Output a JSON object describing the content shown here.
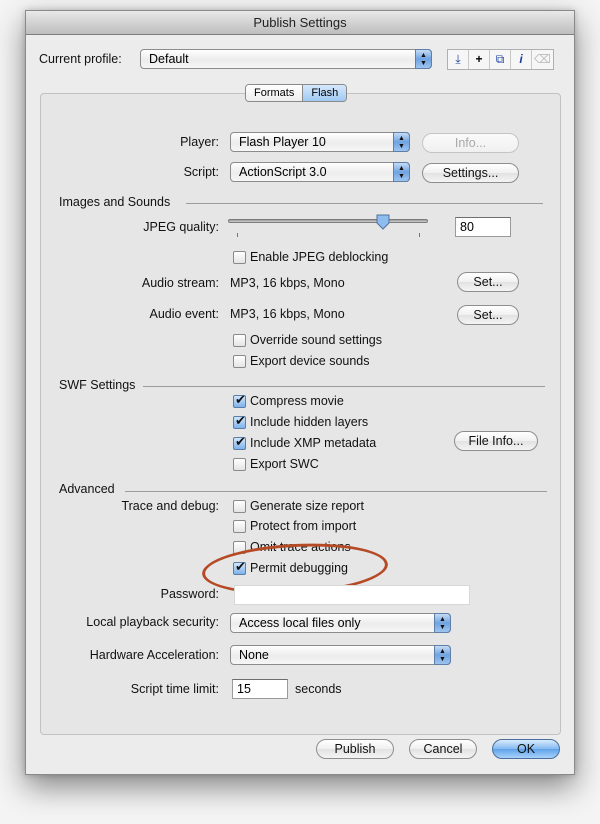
{
  "window": {
    "title": "Publish Settings"
  },
  "profile": {
    "label": "Current profile:",
    "value": "Default",
    "tools": [
      {
        "icon": "import-export-icon",
        "glyph": "⤓"
      },
      {
        "icon": "add-profile-icon",
        "glyph": "+"
      },
      {
        "icon": "duplicate-profile-icon",
        "glyph": "⧉"
      },
      {
        "icon": "profile-info-icon",
        "glyph": "ℹ"
      },
      {
        "icon": "delete-profile-icon",
        "glyph": "🗑"
      }
    ]
  },
  "tabs": [
    {
      "label": "Formats",
      "active": false
    },
    {
      "label": "Flash",
      "active": true
    }
  ],
  "player": {
    "label": "Player:",
    "value": "Flash Player 10",
    "button": "Info..."
  },
  "script": {
    "label": "Script:",
    "value": "ActionScript 3.0",
    "button": "Settings..."
  },
  "images_sounds": {
    "heading": "Images and Sounds",
    "jpeg_label": "JPEG quality:",
    "jpeg_value": "80",
    "jpeg_slider_percent": 80,
    "deblocking": {
      "label": "Enable JPEG deblocking",
      "checked": false
    },
    "audio_stream": {
      "label": "Audio stream:",
      "value": "MP3, 16 kbps, Mono",
      "button": "Set..."
    },
    "audio_event": {
      "label": "Audio event:",
      "value": "MP3, 16 kbps, Mono",
      "button": "Set..."
    },
    "override": {
      "label": "Override sound settings",
      "checked": false
    },
    "export_device": {
      "label": "Export device sounds",
      "checked": false
    }
  },
  "swf": {
    "heading": "SWF Settings",
    "compress": {
      "label": "Compress movie",
      "checked": true
    },
    "hidden_layers": {
      "label": "Include hidden layers",
      "checked": true
    },
    "xmp": {
      "label": "Include XMP metadata",
      "checked": true
    },
    "swc": {
      "label": "Export SWC",
      "checked": false
    },
    "file_info_button": "File Info..."
  },
  "advanced": {
    "heading": "Advanced",
    "trace_label": "Trace and debug:",
    "size_report": {
      "label": "Generate size report",
      "checked": false
    },
    "protect": {
      "label": "Protect from import",
      "checked": false
    },
    "omit_trace": {
      "label": "Omit trace actions",
      "checked": false
    },
    "permit_debug": {
      "label": "Permit debugging",
      "checked": true
    },
    "password_label": "Password:",
    "password_value": "",
    "local_security": {
      "label": "Local playback security:",
      "value": "Access local files only"
    },
    "hw_accel": {
      "label": "Hardware Acceleration:",
      "value": "None"
    },
    "time_limit": {
      "label": "Script time limit:",
      "value": "15",
      "unit": "seconds"
    }
  },
  "footer": {
    "publish": "Publish",
    "cancel": "Cancel",
    "ok": "OK"
  },
  "annotation": {
    "color": "#b54a25"
  }
}
